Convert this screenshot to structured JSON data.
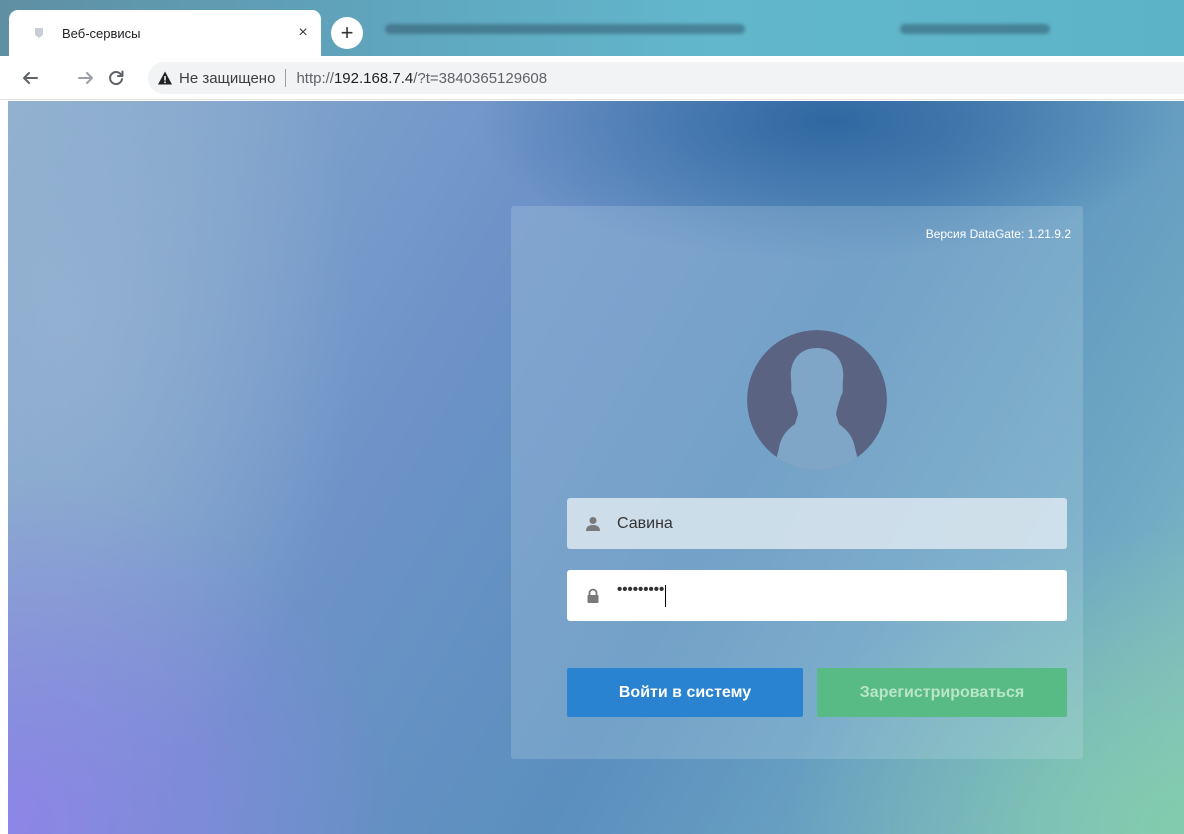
{
  "browser": {
    "tab": {
      "title": "Веб-сервисы",
      "close_glyph": "×"
    },
    "new_tab_glyph": "+",
    "nav": {
      "back_icon": "arrow-left-icon",
      "forward_icon": "arrow-right-icon",
      "reload_icon": "reload-icon"
    },
    "omnibox": {
      "security_label": "Не защищено",
      "url_prefix": "http://",
      "url_host": "192.168.7.4",
      "url_rest": "/?t=3840365129608"
    }
  },
  "login": {
    "version": "Версия DataGate: 1.21.9.2",
    "username": {
      "value": "Савина",
      "icon": "user-icon"
    },
    "password": {
      "masked_value": "•••••••••",
      "icon": "lock-icon"
    },
    "login_button": "Войти в систему",
    "register_button": "Зарегистрироваться"
  },
  "colors": {
    "login_button": "#2a83d0",
    "register_button": "#58bb85",
    "avatar": "#5a6382"
  }
}
